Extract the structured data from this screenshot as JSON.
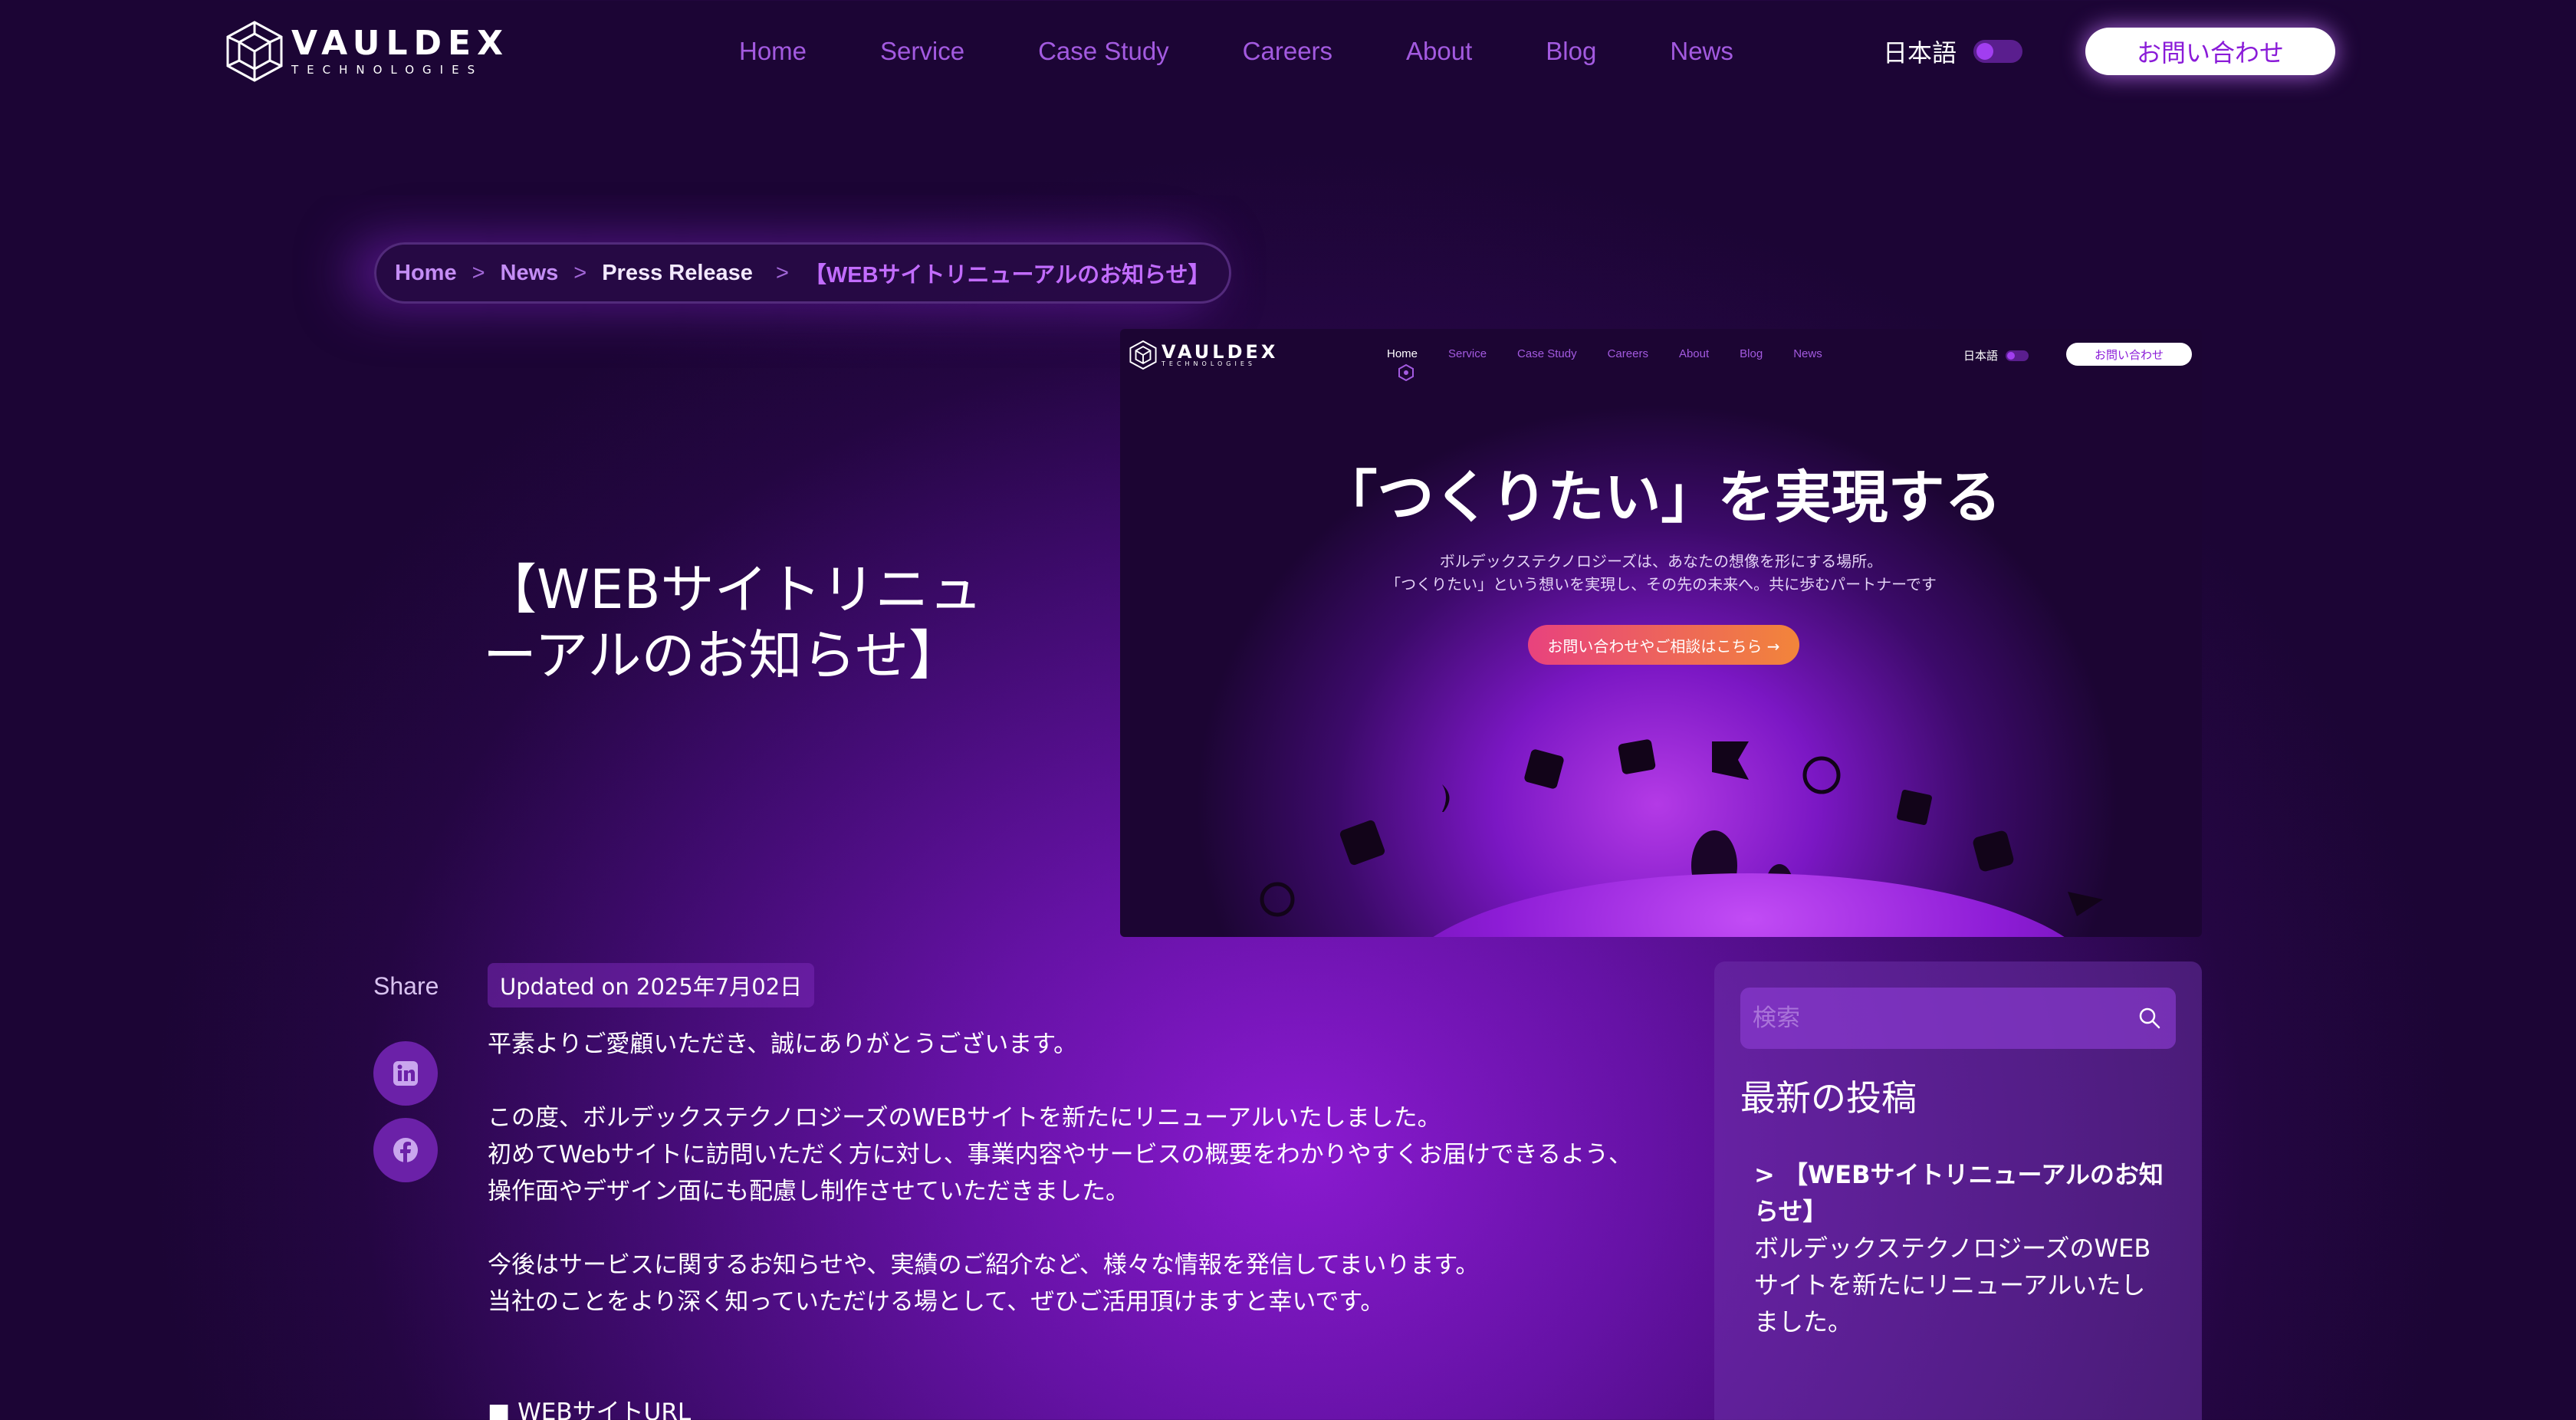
{
  "nav": {
    "logo_name": "VAULDEX",
    "logo_sub": "TECHNOLOGIES",
    "items": [
      "Home",
      "Service",
      "Case Study",
      "Careers",
      "About",
      "Blog",
      "News"
    ],
    "lang": "日本語",
    "cta": "お問い合わせ"
  },
  "breadcrumb": {
    "home": "Home",
    "news": "News",
    "press": "Press Release",
    "sep": ">",
    "current": "【WEBサイトリニューアルのお知らせ】"
  },
  "article": {
    "title": "【WEBサイトリニューアルのお知らせ】",
    "updated": "Updated on 2025年7月02日",
    "paragraphs": [
      "平素よりご愛顧いただき、誠にありがとうございます。",
      "この度、ボルデックステクノロジーズのWEBサイトを新たにリニューアルいたしました。\n初めてWebサイトに訪問いただく方に対し、事業内容やサービスの概要をわかりやすくお届けできるよう、\n操作面やデザイン面にも配慮し制作させていただきました。",
      "今後はサービスに関するお知らせや、実績のご紹介など、様々な情報を発信してまいります。\n当社のことをより深く知っていただける場として、ぜひご活用頂けますと幸いです。"
    ],
    "url_label": "■ WEBサイトURL"
  },
  "share": {
    "label": "Share"
  },
  "hero": {
    "logo_name": "VAULDEX",
    "logo_sub": "TECHNOLOGIES",
    "menu": [
      "Home",
      "Service",
      "Case Study",
      "Careers",
      "About",
      "Blog",
      "News"
    ],
    "lang": "日本語",
    "cta": "お問い合わせ",
    "headline": "「つくりたい」を実現する",
    "sub1": "ボルデックステクノロジーズは、あなたの想像を形にする場所。",
    "sub2": "「つくりたい」という想いを実現し、その先の未来へ。共に歩むパートナーです",
    "button": "お問い合わせやご相談はこちら →"
  },
  "sidebar": {
    "search_placeholder": "検索",
    "title": "最新の投稿",
    "post_title": "> 【WEBサイトリニューアルのお知らせ】",
    "post_excerpt": "ボルデックステクノロジーズのWEBサイトを新たにリニューアルいたしました。"
  },
  "colors": {
    "accent": "#a35ae0",
    "cta_text": "#8a1bd8",
    "background_center": "#8a1ad0",
    "background_edge": "#1c0535"
  }
}
